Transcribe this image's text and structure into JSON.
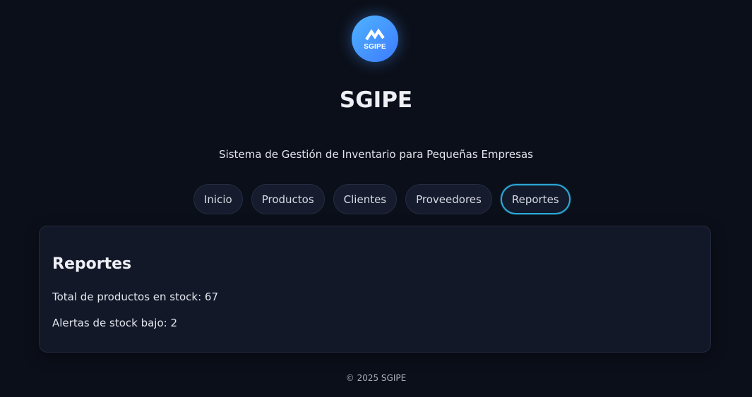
{
  "header": {
    "logo_text": "SGIPE",
    "title": "SGIPE",
    "subtitle": "Sistema de Gestión de Inventario para Pequeñas Empresas"
  },
  "nav": {
    "items": [
      {
        "label": "Inicio",
        "active": false
      },
      {
        "label": "Productos",
        "active": false
      },
      {
        "label": "Clientes",
        "active": false
      },
      {
        "label": "Proveedores",
        "active": false
      },
      {
        "label": "Reportes",
        "active": true
      }
    ]
  },
  "report": {
    "heading": "Reportes",
    "total_stock": "Total de productos en stock: 67",
    "low_stock_alerts": "Alertas de stock bajo: 2"
  },
  "footer": {
    "copyright": "© 2025 SGIPE"
  },
  "colors": {
    "background": "#0b0f19",
    "accent": "#2aa9d6",
    "logo_gradient_start": "#4fb3ff",
    "logo_gradient_end": "#3d7bff"
  }
}
